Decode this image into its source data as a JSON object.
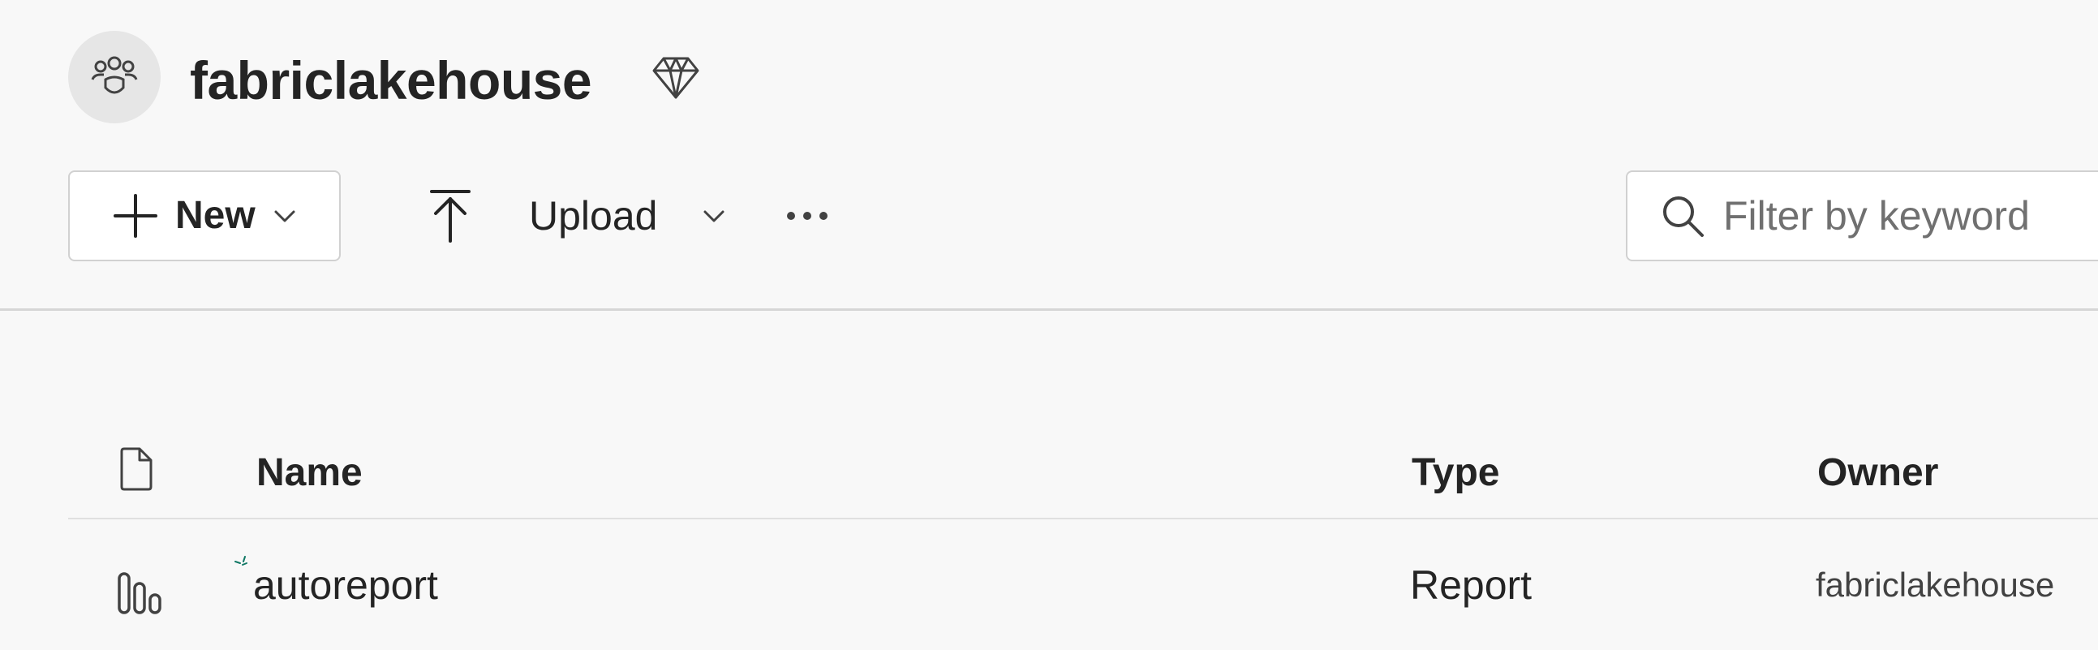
{
  "header": {
    "avatar_icon": "workspace-group-icon",
    "title": "fabriclakehouse",
    "premium_icon": "diamond-icon"
  },
  "toolbar": {
    "new_label": "New",
    "upload_label": "Upload",
    "more_icon": "ellipsis-icon",
    "search_placeholder": "Filter by keyword"
  },
  "table": {
    "columns": [
      "Name",
      "Type",
      "Owner"
    ],
    "rows": [
      {
        "name": "autoreport",
        "type": "Report",
        "owner": "fabriclakehouse",
        "icon": "report-bar-chart-icon"
      }
    ]
  },
  "colors": {
    "background": "#f8f8f8",
    "text": "#242424",
    "border": "#d1d1d1",
    "accent_spark": "#117865"
  }
}
